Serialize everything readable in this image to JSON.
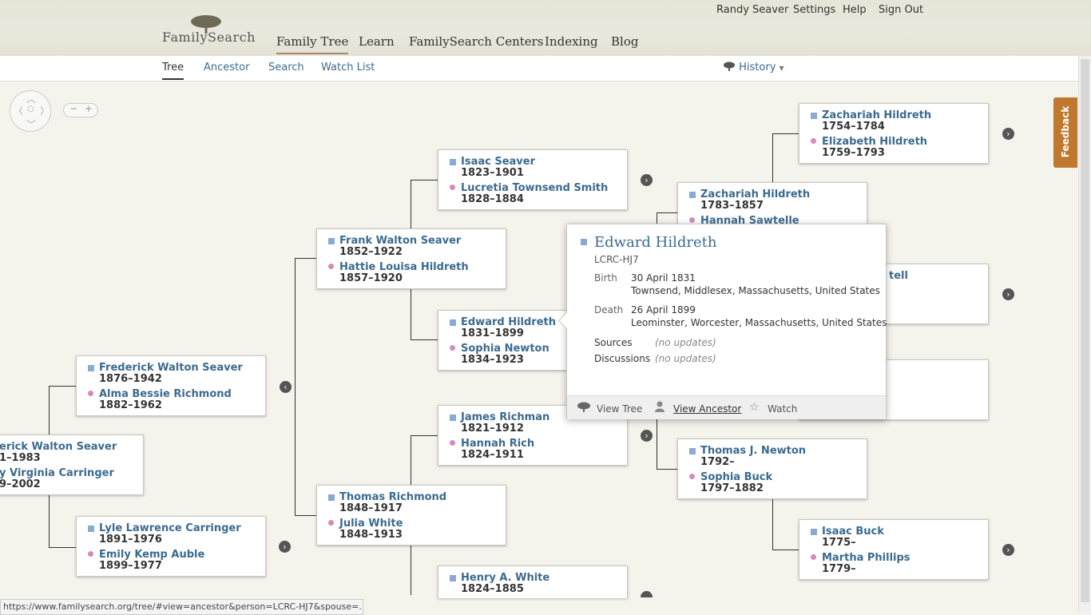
{
  "header": {
    "logo": {
      "name": "FamilySearch"
    },
    "user_links": [
      {
        "label": "Randy Seaver"
      },
      {
        "label": "Settings"
      },
      {
        "label": "Help"
      },
      {
        "label": "Sign Out"
      }
    ],
    "nav": [
      {
        "label": "Family Tree",
        "active": true
      },
      {
        "label": "Learn"
      },
      {
        "label": "FamilySearch Centers"
      },
      {
        "label": "Indexing"
      },
      {
        "label": "Blog"
      }
    ]
  },
  "subnav": {
    "tabs": [
      {
        "label": "Tree",
        "active": true
      },
      {
        "label": "Ancestor"
      },
      {
        "label": "Search"
      },
      {
        "label": "Watch List"
      }
    ],
    "history": {
      "label": "History",
      "icon": "tree-icon"
    }
  },
  "controls": {
    "zoom_out": "−",
    "zoom_in": "+"
  },
  "feedback": {
    "label": "Feedback"
  },
  "couples": {
    "c1": {
      "husband": "Zachariah Hildreth",
      "husband_dates": "1754–1784",
      "wife": "Elizabeth Hildreth",
      "wife_dates": "1759–1793"
    },
    "c2": {
      "husband": "Isaac Seaver",
      "husband_dates": "1823–1901",
      "wife": "Lucretia Townsend Smith",
      "wife_dates": "1828–1884"
    },
    "c3": {
      "husband": "Zachariah Hildreth",
      "husband_dates": "1783–1857",
      "wife": "Hannah Sawtelle",
      "wife_dates": ""
    },
    "c4": {
      "husband": "Frank Walton Seaver",
      "husband_dates": "1852–1922",
      "wife": "Hattie Louisa Hildreth",
      "wife_dates": "1857–1920"
    },
    "c5": {
      "husband_partial": "tell"
    },
    "c6": {
      "husband": "Edward Hildreth",
      "husband_dates": "1831–1899",
      "wife": "Sophia Newton",
      "wife_dates": "1834–1923"
    },
    "c7": {
      "husband": "Frederick Walton Seaver",
      "husband_dates": "1876–1942",
      "wife": "Alma Bessie Richmond",
      "wife_dates": "1882–1962"
    },
    "c8": {
      "husband": "James Richman",
      "husband_dates": "1821–1912",
      "wife": "Hannah Rich",
      "wife_dates": "1824–1911"
    },
    "c9": {
      "husband": "erick Walton Seaver",
      "husband_dates": "1–1983",
      "wife": "y Virginia Carringer",
      "wife_dates": "9–2002"
    },
    "c10": {
      "husband": "Thomas J. Newton",
      "husband_dates": "1792–",
      "wife": "Sophia Buck",
      "wife_dates": "1797–1882"
    },
    "c11": {
      "husband": "Thomas Richmond",
      "husband_dates": "1848–1917",
      "wife": "Julia White",
      "wife_dates": "1848–1913"
    },
    "c12": {
      "husband": "Lyle Lawrence Carringer",
      "husband_dates": "1891–1976",
      "wife": "Emily Kemp Auble",
      "wife_dates": "1899–1977"
    },
    "c13": {
      "husband": "Isaac Buck",
      "husband_dates": "1775–",
      "wife": "Martha Phillips",
      "wife_dates": "1779–"
    },
    "c14": {
      "husband": "Henry A. White",
      "husband_dates": "1824–1885"
    }
  },
  "popup": {
    "name": "Edward Hildreth",
    "id": "LCRC-HJ7",
    "birth_label": "Birth",
    "birth_date": "30 April 1831",
    "birth_place": "Townsend, Middlesex, Massachusetts, United States",
    "death_label": "Death",
    "death_date": "26 April 1899",
    "death_place": "Leominster, Worcester, Massachusetts, United States",
    "sources_label": "Sources",
    "sources_value": "(no updates)",
    "discussions_label": "Discussions",
    "discussions_value": "(no updates)",
    "actions": {
      "view_tree": "View Tree",
      "view_ancestor": "View Ancestor",
      "watch": "Watch"
    }
  },
  "status_bar": {
    "url": "https://www.familysearch.org/tree/#view=ancestor&person=LCRC-HJ7&spouse=..."
  },
  "colors": {
    "link": "#3b6a8f",
    "male_marker": "#8aaad0",
    "female_marker": "#d58aba",
    "feedback": "#c0782e"
  }
}
